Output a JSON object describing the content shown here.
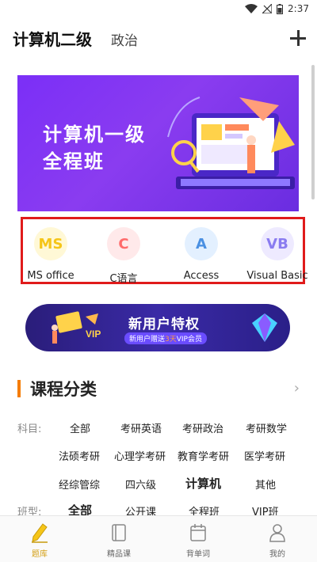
{
  "status_bar": {
    "time": "2:37"
  },
  "header": {
    "title": "计算机二级",
    "subtitle": "政治"
  },
  "banner": {
    "line1": "计算机一级",
    "line2": "全程班"
  },
  "courses": [
    {
      "icon_text": "MS",
      "label": "MS office",
      "color": "#f5c518"
    },
    {
      "icon_text": "C",
      "label": "C语言",
      "color": "#ff6b6b"
    },
    {
      "icon_text": "A",
      "label": "Access",
      "color": "#4a90e2"
    },
    {
      "icon_text": "VB",
      "label": "Visual Basic",
      "color": "#8a7cf0"
    }
  ],
  "promo": {
    "title": "新用户特权",
    "sub_prefix": "新用户赠送",
    "sub_highlight": "3天",
    "sub_suffix": "VIP会员",
    "badge": "VIP"
  },
  "section": {
    "title": "课程分类"
  },
  "categories": {
    "subject_label": "科目:",
    "type_label": "班型:",
    "subjects": [
      "全部",
      "考研英语",
      "考研政治",
      "考研数学",
      "法硕考研",
      "心理学考研",
      "教育学考研",
      "医学考研",
      "经综管综",
      "四六级",
      "计算机",
      "其他"
    ],
    "types": [
      "全部",
      "公开课",
      "全程班",
      "VIP班"
    ]
  },
  "tabs": [
    {
      "label": "题库",
      "icon": "pencil-icon",
      "active": true
    },
    {
      "label": "精品课",
      "icon": "book-icon",
      "active": false
    },
    {
      "label": "背单词",
      "icon": "calendar-icon",
      "active": false
    },
    {
      "label": "我的",
      "icon": "user-icon",
      "active": false
    }
  ]
}
